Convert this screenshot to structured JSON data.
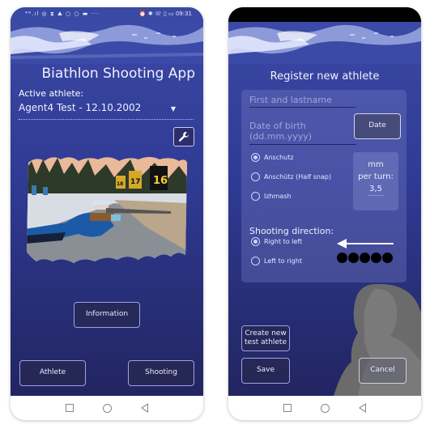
{
  "status_bar": {
    "left_icons": "⁴ᴳ.ıl ◎ ⧗ ⛰ ○ ○ ▬ ···",
    "right_icons": "⏰ ✱ ☏ ▯ ▭",
    "time": "09:31"
  },
  "screen_main": {
    "title": "Biathlon Shooting App",
    "active_athlete_label": "Active athlete:",
    "active_athlete_value": "Agent4 Test - 12.10.2002",
    "settings_icon": "wrench-icon",
    "photo_description": "biathlete shooting prone at range, targets 16 and 17",
    "target_numbers": [
      "16",
      "17",
      "18"
    ],
    "buttons": {
      "information": "Information",
      "athlete": "Athlete",
      "shooting": "Shooting"
    }
  },
  "screen_register": {
    "title": "Register new athlete",
    "name_placeholder": "First and lastname",
    "dob_placeholder_line1": "Date of birth",
    "dob_placeholder_line2": "(dd.mm.yyyy)",
    "date_button": "Date",
    "rifle_options": [
      {
        "label": "Anschutz",
        "selected": true
      },
      {
        "label": "Anschütz (Half snap)",
        "selected": false
      },
      {
        "label": "Izhmash",
        "selected": false
      }
    ],
    "mm_label_line1": "mm",
    "mm_label_line2": "per turn:",
    "mm_value": "3,5",
    "shooting_direction_label": "Shooting direction:",
    "direction_options": [
      {
        "label": "Right to left",
        "selected": true
      },
      {
        "label": "Left to right",
        "selected": false
      }
    ],
    "target_dots": 5,
    "buttons": {
      "create_test_line1": "Create new",
      "create_test_line2": "test athlete",
      "save": "Save",
      "cancel": "Cancel"
    }
  },
  "nav_bar": {
    "recents": "square-icon",
    "home": "circle-icon",
    "back": "triangle-back-icon"
  }
}
